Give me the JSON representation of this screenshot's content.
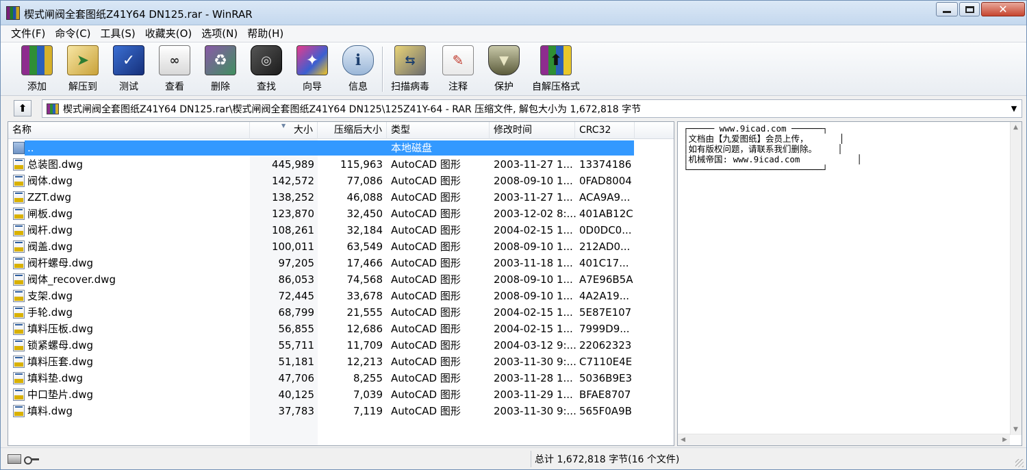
{
  "window": {
    "title": "楔式闸阀全套图纸Z41Y64  DN125.rar - WinRAR"
  },
  "menu": [
    {
      "id": "file",
      "label": "文件(F)"
    },
    {
      "id": "commands",
      "label": "命令(C)"
    },
    {
      "id": "tools",
      "label": "工具(S)"
    },
    {
      "id": "favorites",
      "label": "收藏夹(O)"
    },
    {
      "id": "options",
      "label": "选项(N)"
    },
    {
      "id": "help",
      "label": "帮助(H)"
    }
  ],
  "toolbar": [
    {
      "id": "add",
      "label": "添加",
      "icon": "add-icon"
    },
    {
      "id": "extract",
      "label": "解压到",
      "icon": "extract-icon"
    },
    {
      "id": "test",
      "label": "测试",
      "icon": "test-icon"
    },
    {
      "id": "view",
      "label": "查看",
      "icon": "view-icon"
    },
    {
      "id": "delete",
      "label": "删除",
      "icon": "delete-icon"
    },
    {
      "id": "find",
      "label": "查找",
      "icon": "find-icon"
    },
    {
      "id": "wizard",
      "label": "向导",
      "icon": "wizard-icon"
    },
    {
      "id": "info",
      "label": "信息",
      "icon": "info-icon"
    },
    {
      "id": "virusscan",
      "label": "扫描病毒",
      "icon": "virus-scan-icon"
    },
    {
      "id": "comment",
      "label": "注释",
      "icon": "comment-icon"
    },
    {
      "id": "protect",
      "label": "保护",
      "icon": "protect-icon"
    },
    {
      "id": "sfx",
      "label": "自解压格式",
      "icon": "sfx-icon"
    }
  ],
  "address": {
    "path": "楔式闸阀全套图纸Z41Y64  DN125.rar\\楔式闸阀全套图纸Z41Y64  DN125\\125Z41Y-64 - RAR 压缩文件, 解包大小为 1,672,818 字节",
    "dropdown_glyph": "▼"
  },
  "columns": {
    "name": "名称",
    "size": "大小",
    "packed": "压缩后大小",
    "type": "类型",
    "mtime": "修改时间",
    "crc": "CRC32"
  },
  "parent_row": {
    "name": "..",
    "type": "本地磁盘"
  },
  "files": [
    {
      "name": "总装图.dwg",
      "size": "445,989",
      "packed": "115,963",
      "type": "AutoCAD 图形",
      "mtime": "2003-11-27 1...",
      "crc": "13374186"
    },
    {
      "name": "阀体.dwg",
      "size": "142,572",
      "packed": "77,086",
      "type": "AutoCAD 图形",
      "mtime": "2008-09-10 1...",
      "crc": "0FAD8004"
    },
    {
      "name": "ZZT.dwg",
      "size": "138,252",
      "packed": "46,088",
      "type": "AutoCAD 图形",
      "mtime": "2003-11-27 1...",
      "crc": "ACA9A9..."
    },
    {
      "name": "闸板.dwg",
      "size": "123,870",
      "packed": "32,450",
      "type": "AutoCAD 图形",
      "mtime": "2003-12-02 8:...",
      "crc": "401AB12C"
    },
    {
      "name": "阀杆.dwg",
      "size": "108,261",
      "packed": "32,184",
      "type": "AutoCAD 图形",
      "mtime": "2004-02-15 1...",
      "crc": "0D0DC0..."
    },
    {
      "name": "阀盖.dwg",
      "size": "100,011",
      "packed": "63,549",
      "type": "AutoCAD 图形",
      "mtime": "2008-09-10 1...",
      "crc": "212AD0..."
    },
    {
      "name": "阀杆螺母.dwg",
      "size": "97,205",
      "packed": "17,466",
      "type": "AutoCAD 图形",
      "mtime": "2003-11-18 1...",
      "crc": "401C17..."
    },
    {
      "name": "阀体_recover.dwg",
      "size": "86,053",
      "packed": "74,568",
      "type": "AutoCAD 图形",
      "mtime": "2008-09-10 1...",
      "crc": "A7E96B5A"
    },
    {
      "name": "支架.dwg",
      "size": "72,445",
      "packed": "33,678",
      "type": "AutoCAD 图形",
      "mtime": "2008-09-10 1...",
      "crc": "4A2A19..."
    },
    {
      "name": "手轮.dwg",
      "size": "68,799",
      "packed": "21,555",
      "type": "AutoCAD 图形",
      "mtime": "2004-02-15 1...",
      "crc": "5E87E107"
    },
    {
      "name": "填料压板.dwg",
      "size": "56,855",
      "packed": "12,686",
      "type": "AutoCAD 图形",
      "mtime": "2004-02-15 1...",
      "crc": "7999D9..."
    },
    {
      "name": "锁紧螺母.dwg",
      "size": "55,711",
      "packed": "11,709",
      "type": "AutoCAD 图形",
      "mtime": "2004-03-12 9:...",
      "crc": "22062323"
    },
    {
      "name": "填料压套.dwg",
      "size": "51,181",
      "packed": "12,213",
      "type": "AutoCAD 图形",
      "mtime": "2003-11-30 9:...",
      "crc": "C7110E4E"
    },
    {
      "name": "填料垫.dwg",
      "size": "47,706",
      "packed": "8,255",
      "type": "AutoCAD 图形",
      "mtime": "2003-11-28 1...",
      "crc": "5036B9E3"
    },
    {
      "name": "中口垫片.dwg",
      "size": "40,125",
      "packed": "7,039",
      "type": "AutoCAD 图形",
      "mtime": "2003-11-29 1...",
      "crc": "BFAE8707"
    },
    {
      "name": "填料.dwg",
      "size": "37,783",
      "packed": "7,119",
      "type": "AutoCAD 图形",
      "mtime": "2003-11-30 9:...",
      "crc": "565F0A9B"
    }
  ],
  "comment": {
    "text": "┌───── www.9icad.com ──────┐\n│文档由【九爱图纸】会员上传，      │\n│如有版权问题，请联系我们删除。    │\n│机械帝国: www.9icad.com           │\n└──────────────────────────┘"
  },
  "status": {
    "total": "总计 1,672,818 字节(16 个文件)"
  },
  "colors": {
    "selection": "#3399ff",
    "title_bar": "#c4d8ee"
  }
}
